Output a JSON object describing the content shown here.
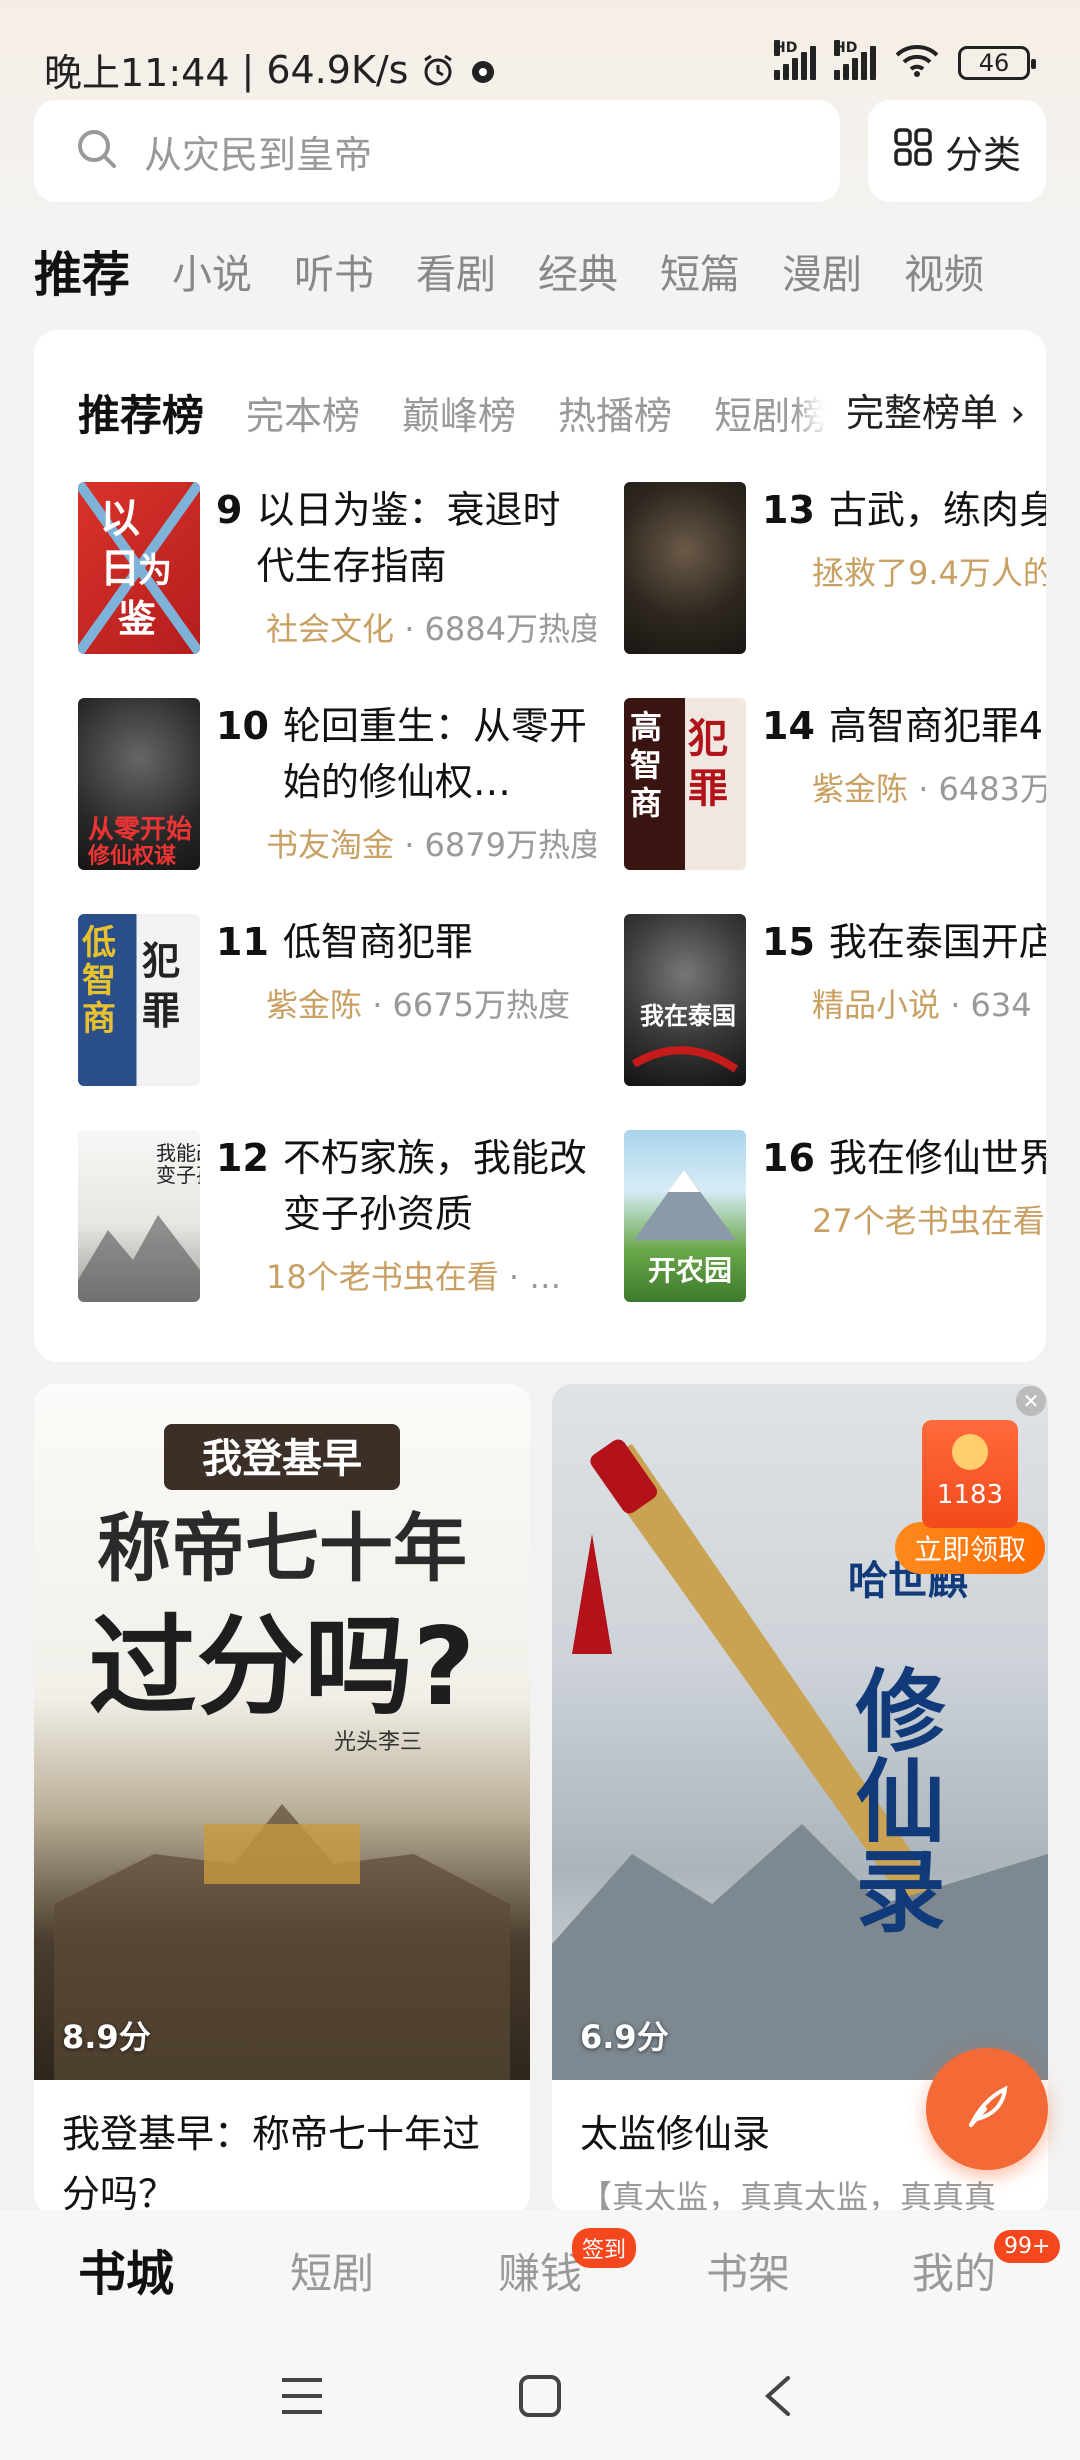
{
  "status_bar": {
    "time": "晚上11:44",
    "speed": "64.9K/s",
    "battery": "46",
    "hd1": "HD",
    "hd2": "HD"
  },
  "search": {
    "placeholder": "从灾民到皇帝",
    "category_label": "分类"
  },
  "top_tabs": [
    "推荐",
    "小说",
    "听书",
    "看剧",
    "经典",
    "短篇",
    "漫剧",
    "视频"
  ],
  "ranking": {
    "tabs": [
      "推荐榜",
      "完本榜",
      "巅峰榜",
      "热播榜",
      "短剧榜"
    ],
    "full_list_label": "完整榜单 ›",
    "items": [
      {
        "num": "9",
        "title": "以日为鉴：衰退时代生存指南",
        "author": "社会文化",
        "meta": " · 6884万热度"
      },
      {
        "num": "10",
        "title": "轮回重生：从零开始的修仙权…",
        "author": "书友淘金",
        "meta": " · 6879万热度"
      },
      {
        "num": "11",
        "title": "低智商犯罪",
        "author": "紫金陈",
        "meta": " · 6675万热度"
      },
      {
        "num": "12",
        "title": "不朽家族，我能改变子孙资质",
        "author": "18个老书虫在看",
        "meta": " · …"
      },
      {
        "num": "13",
        "title": "古武，练肉身",
        "author": "拯救了9.4万人的",
        "meta": ""
      },
      {
        "num": "14",
        "title": "高智商犯罪4",
        "author": "紫金陈",
        "meta": " · 6483万"
      },
      {
        "num": "15",
        "title": "我在泰国开店",
        "author": "精品小说",
        "meta": " · 634"
      },
      {
        "num": "16",
        "title": "我在修仙世界",
        "author": "27个老书虫在看",
        "meta": ""
      }
    ]
  },
  "features": [
    {
      "title": "我登基早：称帝七十年过分吗？",
      "score": "8.9分",
      "cover_line1": "我登基早",
      "cover_line2": "称帝七十年",
      "cover_line3": "过分吗?",
      "cover_author": "光头李三"
    },
    {
      "title": "太监修仙录",
      "score": "6.9分",
      "desc": "【真太监，真真太监，真真真",
      "cover_author": "哈世麒",
      "cover_text": "监修仙录"
    }
  ],
  "red_packet": {
    "amount": "1183",
    "button": "立即领取"
  },
  "bottom_nav": {
    "items": [
      "书城",
      "短剧",
      "赚钱",
      "书架",
      "我的"
    ],
    "sign_badge": "签到",
    "msg_badge": "99+"
  },
  "colors": {
    "accent": "#f36a36",
    "author": "#c9a063",
    "badge": "#f4471e"
  }
}
